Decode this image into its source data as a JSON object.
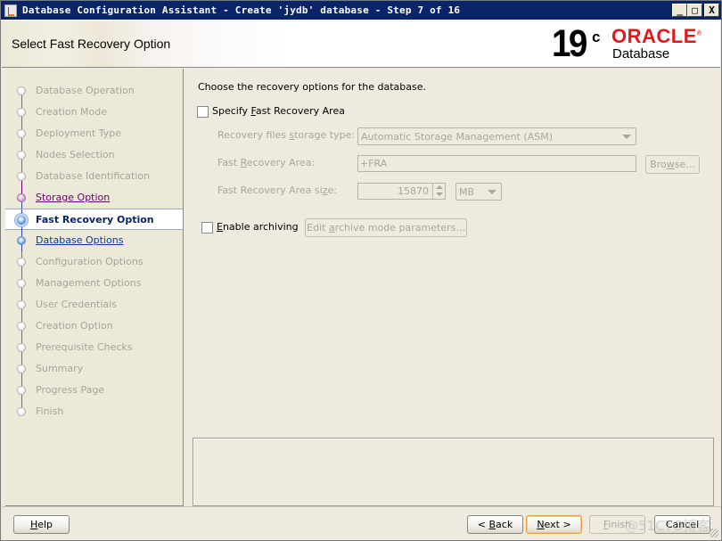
{
  "window": {
    "title": "Database Configuration Assistant - Create 'jydb' database - Step 7 of 16",
    "controls": {
      "minimize": "_",
      "maximize": "□",
      "close": "X"
    }
  },
  "header": {
    "title": "Select Fast Recovery Option",
    "logo": {
      "version": "19",
      "superscript": "c",
      "brand": "ORACLE",
      "brand_mark": "®",
      "product": "Database"
    },
    "brand_color": "#e0191b"
  },
  "sidebar": {
    "steps": [
      {
        "label": "Database Operation",
        "state": "done"
      },
      {
        "label": "Creation Mode",
        "state": "done"
      },
      {
        "label": "Deployment Type",
        "state": "done"
      },
      {
        "label": "Nodes Selection",
        "state": "done"
      },
      {
        "label": "Database Identification",
        "state": "done"
      },
      {
        "label": "Storage Option",
        "state": "visited"
      },
      {
        "label": "Fast Recovery Option",
        "state": "current"
      },
      {
        "label": "Database Options",
        "state": "next"
      },
      {
        "label": "Configuration Options",
        "state": "pending"
      },
      {
        "label": "Management Options",
        "state": "pending"
      },
      {
        "label": "User Credentials",
        "state": "pending"
      },
      {
        "label": "Creation Option",
        "state": "pending"
      },
      {
        "label": "Prerequisite Checks",
        "state": "pending"
      },
      {
        "label": "Summary",
        "state": "pending"
      },
      {
        "label": "Progress Page",
        "state": "pending"
      },
      {
        "label": "Finish",
        "state": "pending"
      }
    ]
  },
  "content": {
    "intro": "Choose the recovery options for the database.",
    "specify_fra": {
      "pre": "Specify ",
      "mnemonic": "F",
      "post": "ast Recovery Area",
      "checked": false
    },
    "storage_type": {
      "pre": "Recovery files ",
      "mnemonic": "s",
      "post": "torage type:",
      "value": "Automatic Storage Management (ASM)"
    },
    "fra_location": {
      "pre": "Fast ",
      "mnemonic": "R",
      "post": "ecovery Area:",
      "value": "+FRA",
      "browse": {
        "pre": "Bro",
        "mnemonic": "w",
        "post": "se..."
      }
    },
    "fra_size": {
      "pre": "Fast Recovery Area si",
      "mnemonic": "z",
      "post": "e:",
      "value": "15870",
      "unit": "MB"
    },
    "archiving": {
      "mnemonic": "E",
      "post": "nable archiving",
      "checked": false,
      "edit_button": {
        "pre": "Edit ",
        "mnemonic": "a",
        "post": "rchive mode parameters..."
      }
    }
  },
  "footer": {
    "help": {
      "mnemonic": "H",
      "post": "elp"
    },
    "back": {
      "pre": "< ",
      "mnemonic": "B",
      "post": "ack"
    },
    "next": {
      "mnemonic": "N",
      "post": "ext >"
    },
    "finish": {
      "mnemonic": "F",
      "post": "inish"
    },
    "cancel": "Cancel",
    "watermark": "@51CTO博客"
  }
}
